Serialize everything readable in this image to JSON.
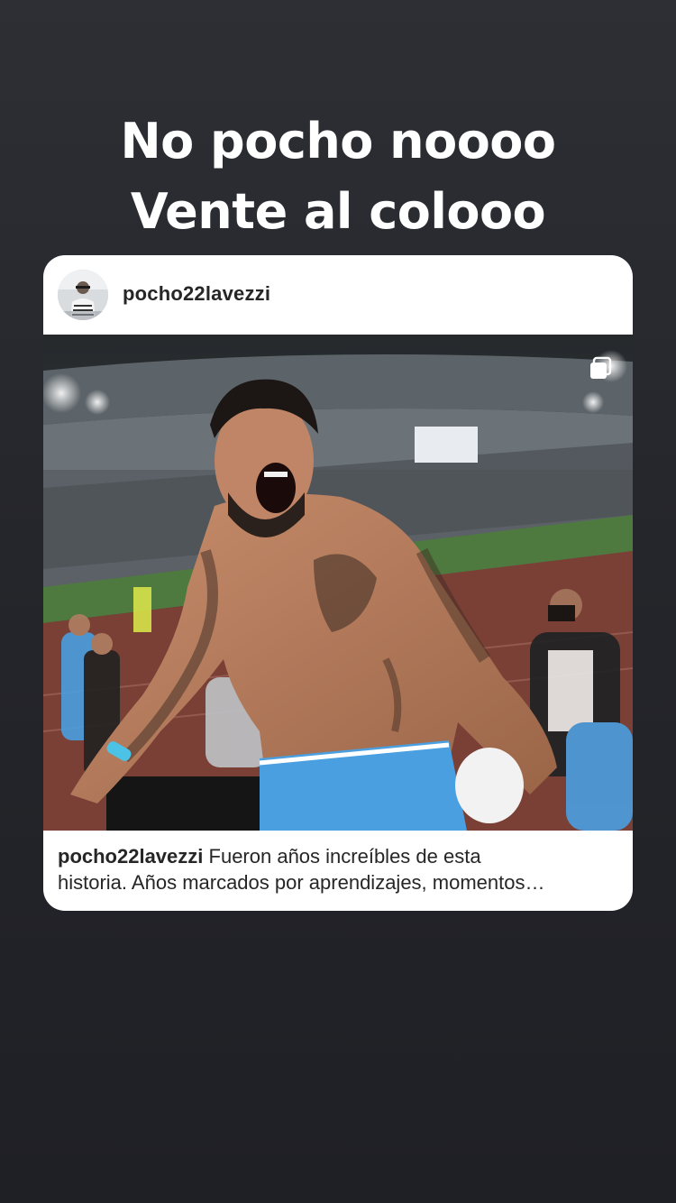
{
  "story": {
    "line1": "No pocho noooo",
    "line2": "Vente al colooo"
  },
  "post": {
    "username": "pocho22lavezzi",
    "caption_user": "pocho22lavezzi",
    "caption_line1": "Fueron años increíbles de esta",
    "caption_line2": "historia. Años marcados por aprendizajes, momentos…",
    "photo_icon": "multiple-photos-icon",
    "avatar_icon": "profile-avatar"
  },
  "colors": {
    "background": "#25262b",
    "text_light": "#ffffff",
    "text_dark": "#262626",
    "card": "#ffffff",
    "jersey_blue": "#4a9fe0"
  }
}
